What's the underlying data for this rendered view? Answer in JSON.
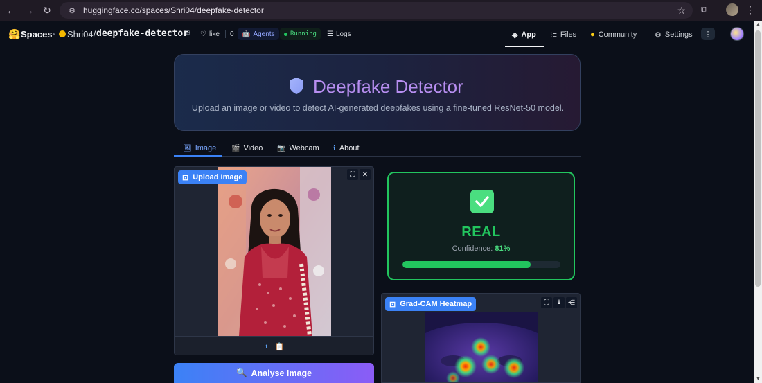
{
  "browser": {
    "url": "huggingface.co/spaces/Shri04/deepfake-detector"
  },
  "hf": {
    "spaces_label": "Spaces",
    "owner": "Shri04/",
    "repo": "deepfake-detector",
    "like_label": "like",
    "like_count": "0",
    "agents_label": "Agents",
    "status_label": "Running",
    "logs_label": "Logs",
    "tabs": {
      "app": "App",
      "files": "Files",
      "community": "Community",
      "settings": "Settings"
    }
  },
  "hero": {
    "title": "Deepfake Detector",
    "subtitle": "Upload an image or video to detect AI-generated deepfakes using a fine-tuned ResNet-50 model."
  },
  "tabs": {
    "image": "Image",
    "video": "Video",
    "webcam": "Webcam",
    "about": "About"
  },
  "upload": {
    "label": "Upload Image"
  },
  "analyse": {
    "label": "Analyse Image"
  },
  "result": {
    "verdict": "REAL",
    "confidence_label": "Confidence:",
    "confidence_value": "81%",
    "confidence_fraction": 0.81
  },
  "heatmap": {
    "label": "Grad-CAM Heatmap"
  },
  "colors": {
    "accent_blue": "#3b82f6",
    "real_green": "#22c55e",
    "title_purple": "#b78ef0"
  }
}
